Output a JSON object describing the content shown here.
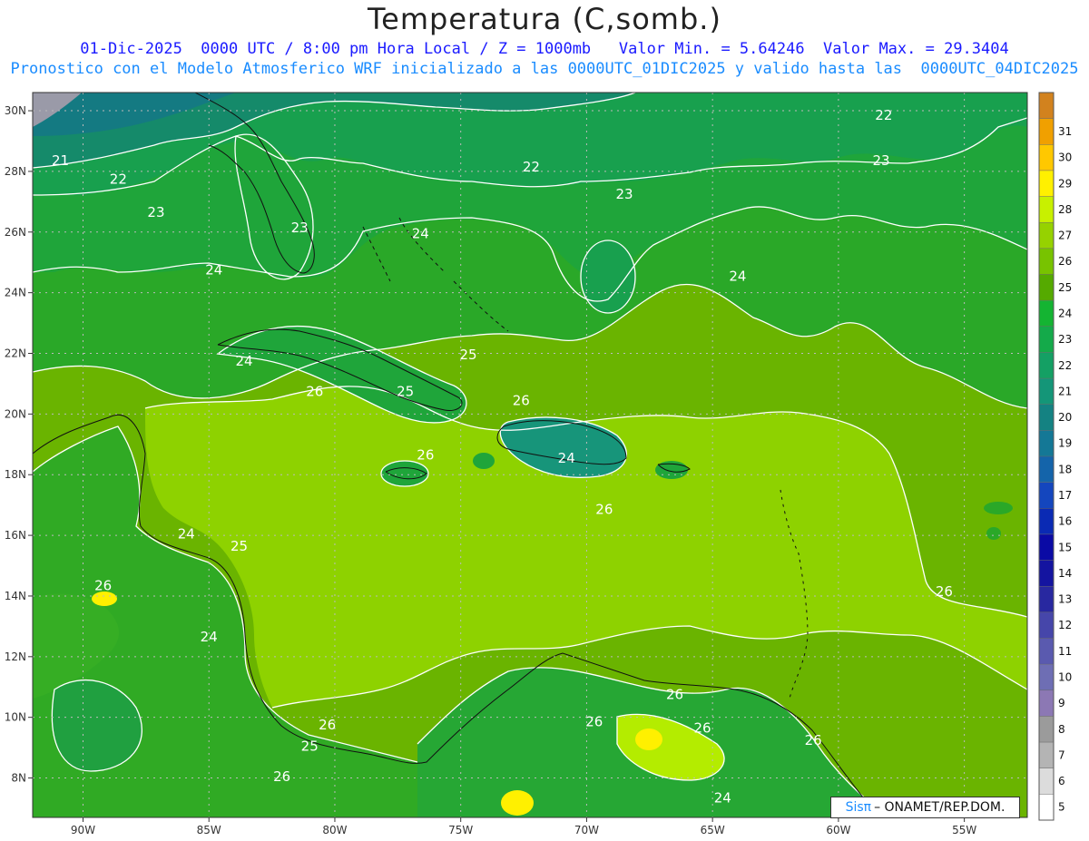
{
  "title": "Temperatura (C,somb.)",
  "subtitle_line1": "01-Dic-2025  0000 UTC / 8:00 pm Hora Local / Z = 1000mb   Valor Min. = 5.64246  Valor Max. = 29.3404",
  "subtitle_line2": "Pronostico con el Modelo Atmosferico WRF inicializado a las 0000UTC_01DIC2025 y valido hasta las  0000UTC_04DIC2025",
  "credit": {
    "brand": "Sisπ",
    "text": "– ONAMET/REP.DOM."
  },
  "map": {
    "lon_range": [
      -92,
      -52.5
    ],
    "lat_range": [
      6.7,
      30.6
    ],
    "lon_ticks": [
      {
        "v": -90,
        "label": "90W"
      },
      {
        "v": -85,
        "label": "85W"
      },
      {
        "v": -80,
        "label": "80W"
      },
      {
        "v": -75,
        "label": "75W"
      },
      {
        "v": -70,
        "label": "70W"
      },
      {
        "v": -65,
        "label": "65W"
      },
      {
        "v": -60,
        "label": "60W"
      },
      {
        "v": -55,
        "label": "55W"
      }
    ],
    "lat_ticks": [
      {
        "v": 30,
        "label": "30N"
      },
      {
        "v": 28,
        "label": "28N"
      },
      {
        "v": 26,
        "label": "26N"
      },
      {
        "v": 24,
        "label": "24N"
      },
      {
        "v": 22,
        "label": "22N"
      },
      {
        "v": 20,
        "label": "20N"
      },
      {
        "v": 18,
        "label": "18N"
      },
      {
        "v": 16,
        "label": "16N"
      },
      {
        "v": 14,
        "label": "14N"
      },
      {
        "v": 12,
        "label": "12N"
      },
      {
        "v": 10,
        "label": "10N"
      },
      {
        "v": 8,
        "label": "8N"
      }
    ],
    "contour_labels": [
      {
        "text": "21",
        "lon": -90.9,
        "lat": 28.2
      },
      {
        "text": "22",
        "lon": -88.6,
        "lat": 27.6
      },
      {
        "text": "23",
        "lon": -87.1,
        "lat": 26.5
      },
      {
        "text": "24",
        "lon": -84.8,
        "lat": 24.6
      },
      {
        "text": "23",
        "lon": -81.4,
        "lat": 26.0
      },
      {
        "text": "24",
        "lon": -76.6,
        "lat": 25.8
      },
      {
        "text": "22",
        "lon": -72.2,
        "lat": 28.0
      },
      {
        "text": "23",
        "lon": -68.5,
        "lat": 27.1
      },
      {
        "text": "24",
        "lon": -64.0,
        "lat": 24.4
      },
      {
        "text": "22",
        "lon": -58.2,
        "lat": 29.7
      },
      {
        "text": "23",
        "lon": -58.3,
        "lat": 28.2
      },
      {
        "text": "24",
        "lon": -83.6,
        "lat": 21.6
      },
      {
        "text": "25",
        "lon": -74.7,
        "lat": 21.8
      },
      {
        "text": "26",
        "lon": -80.8,
        "lat": 20.6
      },
      {
        "text": "25",
        "lon": -77.2,
        "lat": 20.6
      },
      {
        "text": "26",
        "lon": -72.6,
        "lat": 20.3
      },
      {
        "text": "26",
        "lon": -76.4,
        "lat": 18.5
      },
      {
        "text": "24",
        "lon": -70.8,
        "lat": 18.4
      },
      {
        "text": "26",
        "lon": -69.3,
        "lat": 16.7
      },
      {
        "text": "24",
        "lon": -85.9,
        "lat": 15.9
      },
      {
        "text": "25",
        "lon": -83.8,
        "lat": 15.5
      },
      {
        "text": "26",
        "lon": -89.2,
        "lat": 14.2
      },
      {
        "text": "24",
        "lon": -85.0,
        "lat": 12.5
      },
      {
        "text": "26",
        "lon": -80.3,
        "lat": 9.6
      },
      {
        "text": "25",
        "lon": -81.0,
        "lat": 8.9
      },
      {
        "text": "26",
        "lon": -82.1,
        "lat": 7.9
      },
      {
        "text": "26",
        "lon": -66.5,
        "lat": 10.6
      },
      {
        "text": "26",
        "lon": -69.7,
        "lat": 9.7
      },
      {
        "text": "26",
        "lon": -65.4,
        "lat": 9.5
      },
      {
        "text": "26",
        "lon": -55.8,
        "lat": 14.0
      },
      {
        "text": "26",
        "lon": -61.0,
        "lat": 9.1
      },
      {
        "text": "24",
        "lon": -64.6,
        "lat": 7.2
      }
    ]
  },
  "colorbar": {
    "levels": [
      "5",
      "6",
      "7",
      "8",
      "9",
      "10",
      "11",
      "12",
      "13",
      "14",
      "15",
      "16",
      "17",
      "18",
      "19",
      "20",
      "21",
      "22",
      "23",
      "24",
      "25",
      "26",
      "27",
      "28",
      "29",
      "30",
      "31"
    ],
    "colors": [
      "#ffffff",
      "#dcdcdc",
      "#b4b4b4",
      "#9b9b9b",
      "#8c78b4",
      "#6e6eb4",
      "#5a5aaf",
      "#4646aa",
      "#2828a0",
      "#1414a0",
      "#0a0aa5",
      "#0a2ab4",
      "#1446be",
      "#1464aa",
      "#147896",
      "#148282",
      "#149678",
      "#14a064",
      "#14aa4a",
      "#14b432",
      "#55aa00",
      "#78c300",
      "#96d200",
      "#c8f000",
      "#fff000",
      "#ffc800",
      "#f0a000",
      "#d2821e"
    ]
  }
}
